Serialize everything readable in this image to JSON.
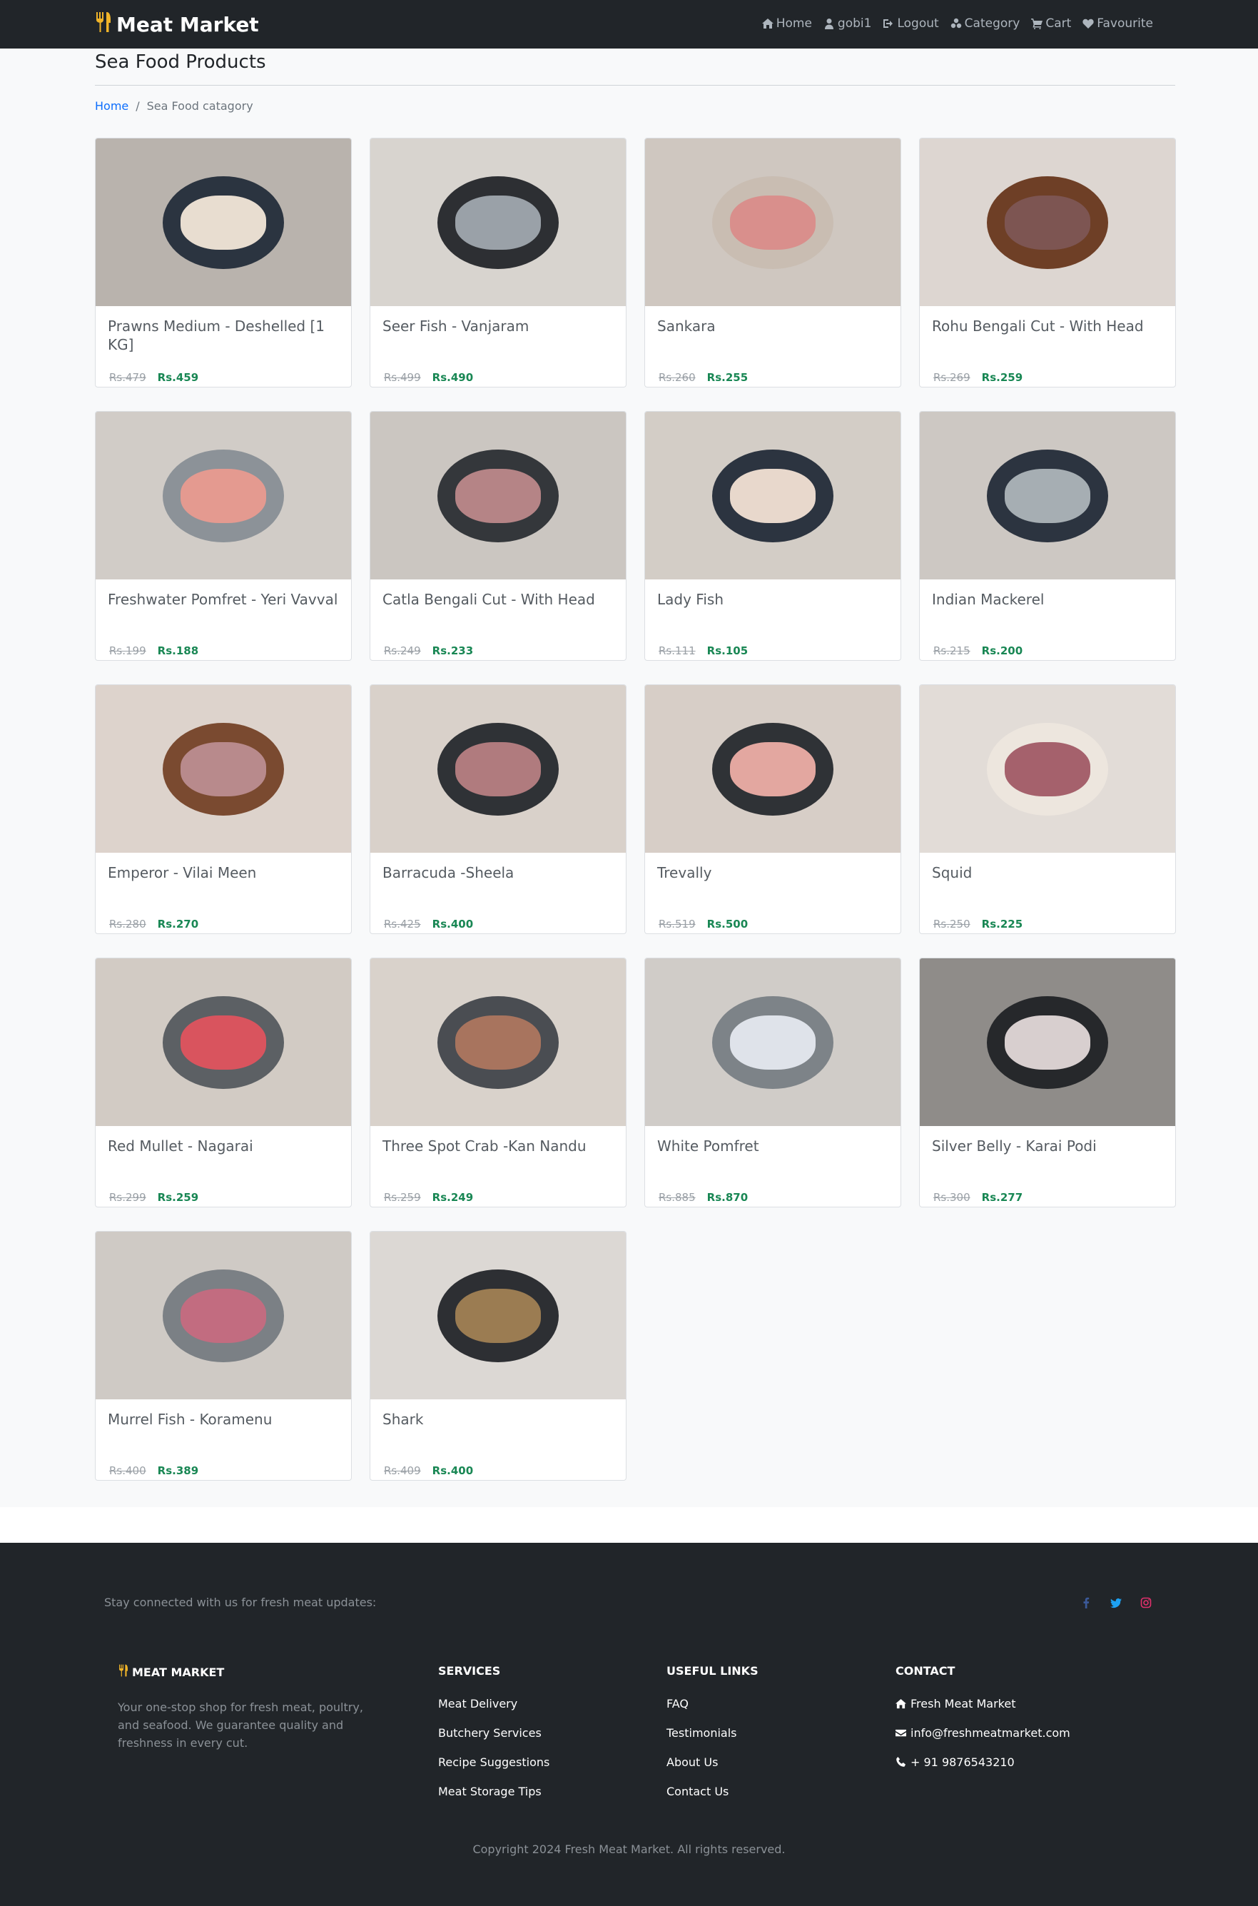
{
  "navbar": {
    "brand": "Meat Market",
    "links": [
      {
        "label": "Home",
        "icon": "home-icon"
      },
      {
        "label": "gobi1",
        "icon": "user-icon"
      },
      {
        "label": "Logout",
        "icon": "logout-icon"
      },
      {
        "label": "Category",
        "icon": "category-icon"
      },
      {
        "label": "Cart",
        "icon": "cart-icon"
      },
      {
        "label": "Favourite",
        "icon": "heart-icon"
      }
    ]
  },
  "page": {
    "title": "Sea Food Products",
    "breadcrumb": {
      "home": "Home",
      "separator": "/",
      "current": "Sea Food catagory"
    }
  },
  "products": [
    {
      "name": "Prawns Medium - Deshelled [1 KG]",
      "old_price": "Rs.479",
      "price": "Rs.459",
      "bg": "#b9b3ad",
      "plate": "#2b3440",
      "food": "#e8ddd0"
    },
    {
      "name": "Seer Fish - Vanjaram",
      "old_price": "Rs.499",
      "price": "Rs.490",
      "bg": "#d8d4cf",
      "plate": "#2d2f33",
      "food": "#9aa1a8"
    },
    {
      "name": "Sankara",
      "old_price": "Rs.260",
      "price": "Rs.255",
      "bg": "#cfc7c0",
      "plate": "#c9bdb2",
      "food": "#d98f8c"
    },
    {
      "name": "Rohu Bengali Cut - With Head",
      "old_price": "Rs.269",
      "price": "Rs.259",
      "bg": "#ddd6d1",
      "plate": "#6e3f26",
      "food": "#7d5552"
    },
    {
      "name": "Freshwater Pomfret - Yeri Vavval",
      "old_price": "Rs.199",
      "price": "Rs.188",
      "bg": "#d1ccc7",
      "plate": "#8c9298",
      "food": "#e49a90"
    },
    {
      "name": "Catla Bengali Cut - With Head",
      "old_price": "Rs.249",
      "price": "Rs.233",
      "bg": "#cbc6c1",
      "plate": "#34373b",
      "food": "#b58486"
    },
    {
      "name": "Lady Fish",
      "old_price": "Rs.111",
      "price": "Rs.105",
      "bg": "#d3cdc6",
      "plate": "#2c3440",
      "food": "#e8d8cc"
    },
    {
      "name": "Indian Mackerel",
      "old_price": "Rs.215",
      "price": "Rs.200",
      "bg": "#cdc8c3",
      "plate": "#2c3440",
      "food": "#a6aeb3"
    },
    {
      "name": "Emperor - Vilai Meen",
      "old_price": "Rs.280",
      "price": "Rs.270",
      "bg": "#ddd3cc",
      "plate": "#7a4a30",
      "food": "#b88a8c"
    },
    {
      "name": "Barracuda -Sheela",
      "old_price": "Rs.425",
      "price": "Rs.400",
      "bg": "#d9d1ca",
      "plate": "#2f3236",
      "food": "#b07b7e"
    },
    {
      "name": "Trevally",
      "old_price": "Rs.519",
      "price": "Rs.500",
      "bg": "#d7cec7",
      "plate": "#2f3236",
      "food": "#e3a7a0"
    },
    {
      "name": "Squid",
      "old_price": "Rs.250",
      "price": "Rs.225",
      "bg": "#e2dcd7",
      "plate": "#ede6de",
      "food": "#a5616c"
    },
    {
      "name": "Red Mullet - Nagarai",
      "old_price": "Rs.299",
      "price": "Rs.259",
      "bg": "#d2cbc4",
      "plate": "#5c6064",
      "food": "#d9545e"
    },
    {
      "name": "Three Spot Crab -Kan Nandu",
      "old_price": "Rs.259",
      "price": "Rs.249",
      "bg": "#d9d2cb",
      "plate": "#4a4d52",
      "food": "#a8745e"
    },
    {
      "name": "White Pomfret",
      "old_price": "Rs.885",
      "price": "Rs.870",
      "bg": "#d0ccc8",
      "plate": "#7d8388",
      "food": "#dfe3ea"
    },
    {
      "name": "Silver Belly - Karai Podi",
      "old_price": "Rs.300",
      "price": "Rs.277",
      "bg": "#8f8c89",
      "plate": "#26282b",
      "food": "#d8cfcf"
    },
    {
      "name": "Murrel Fish - Koramenu",
      "old_price": "Rs.400",
      "price": "Rs.389",
      "bg": "#cfcac5",
      "plate": "#7b8085",
      "food": "#c26c80"
    },
    {
      "name": "Shark",
      "old_price": "Rs.409",
      "price": "Rs.400",
      "bg": "#dcd8d4",
      "plate": "#2d2f33",
      "food": "#9b7c52"
    }
  ],
  "footer": {
    "stay_connected": "Stay connected with us for fresh meat updates:",
    "social": [
      {
        "icon": "facebook-icon",
        "color": "#3b5998"
      },
      {
        "icon": "twitter-icon",
        "color": "#1da1f2"
      },
      {
        "icon": "instagram-icon",
        "color": "#e1306c"
      }
    ],
    "about": {
      "heading": "MEAT MARKET",
      "text": "Your one-stop shop for fresh meat, poultry, and seafood. We guarantee quality and freshness in every cut."
    },
    "services": {
      "heading": "SERVICES",
      "items": [
        "Meat Delivery",
        "Butchery Services",
        "Recipe Suggestions",
        "Meat Storage Tips"
      ]
    },
    "useful_links": {
      "heading": "USEFUL LINKS",
      "items": [
        "FAQ",
        "Testimonials",
        "About Us",
        "Contact Us"
      ]
    },
    "contact": {
      "heading": "CONTACT",
      "name": "Fresh Meat Market",
      "email": "info@freshmeatmarket.com",
      "phone": "+ 91 9876543210"
    },
    "copyright": "Copyright 2024 Fresh Meat Market. All rights reserved."
  },
  "colors": {
    "brand_icon": "#f0b429",
    "navbar": "#212529",
    "price": "#198754",
    "link": "#0d6efd"
  }
}
